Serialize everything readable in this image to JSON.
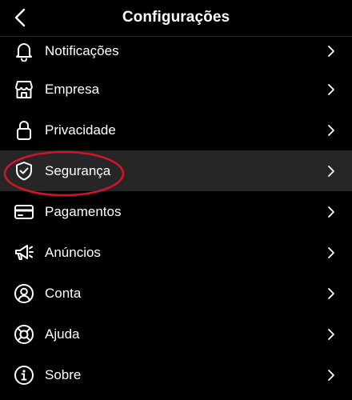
{
  "header": {
    "title": "Configurações"
  },
  "menu": {
    "items": [
      {
        "label": "Notificações",
        "icon": "bell-icon"
      },
      {
        "label": "Empresa",
        "icon": "storefront-icon"
      },
      {
        "label": "Privacidade",
        "icon": "lock-icon"
      },
      {
        "label": "Segurança",
        "icon": "shield-check-icon"
      },
      {
        "label": "Pagamentos",
        "icon": "card-icon"
      },
      {
        "label": "Anúncios",
        "icon": "megaphone-icon"
      },
      {
        "label": "Conta",
        "icon": "user-circle-icon"
      },
      {
        "label": "Ajuda",
        "icon": "lifebuoy-icon"
      },
      {
        "label": "Sobre",
        "icon": "info-icon"
      }
    ]
  },
  "colors": {
    "background": "#000000",
    "highlight_row": "#262626",
    "annotation_ring": "#d0142c",
    "text": "#ffffff"
  }
}
